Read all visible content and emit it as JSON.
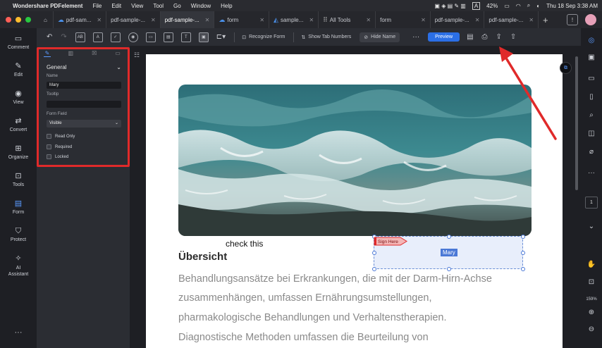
{
  "menubar": {
    "app_name": "Wondershare PDFelement",
    "items": [
      "File",
      "Edit",
      "View",
      "Tool",
      "Go",
      "Window",
      "Help"
    ],
    "battery": "42%",
    "clock": "Thu 18 Sep  3:38 AM",
    "input_indicator": "A"
  },
  "tabs": [
    {
      "label": "pdf-sam...",
      "icon": "cloud"
    },
    {
      "label": "pdf-sample-...",
      "icon": "none"
    },
    {
      "label": "pdf-sample-...",
      "icon": "none",
      "active": true
    },
    {
      "label": "form",
      "icon": "cloud"
    },
    {
      "label": "sample...",
      "icon": "chart"
    },
    {
      "label": "All Tools",
      "icon": "grid"
    },
    {
      "label": "form",
      "icon": "none"
    },
    {
      "label": "pdf-sample-...",
      "icon": "none"
    },
    {
      "label": "pdf-sample-...",
      "icon": "none"
    }
  ],
  "leftnav": [
    {
      "label": "Comment",
      "icon": "comment-icon"
    },
    {
      "label": "Edit",
      "icon": "edit-icon"
    },
    {
      "label": "View",
      "icon": "view-icon"
    },
    {
      "label": "Convert",
      "icon": "convert-icon"
    },
    {
      "label": "Organize",
      "icon": "organize-icon"
    },
    {
      "label": "Tools",
      "icon": "tools-icon"
    },
    {
      "label": "Form",
      "icon": "form-icon",
      "active": true
    },
    {
      "label": "Protect",
      "icon": "protect-icon"
    },
    {
      "label": "AI\nAssistant",
      "icon": "ai-assistant-icon"
    }
  ],
  "toolbar": {
    "recognize": "Recognize Form",
    "tab_numbers": "Show Tab Numbers",
    "hide_name": "Hide Name",
    "preview": "Preview",
    "field_icons": [
      "AB",
      "A",
      "✓",
      "◉",
      "▭",
      "▤",
      "T",
      "▣"
    ]
  },
  "props": {
    "section": "General",
    "name_label": "Name",
    "name_value": "Mary",
    "tooltip_label": "Tooltip",
    "tooltip_value": "",
    "formfield_label": "Form Field",
    "formfield_value": "Visible",
    "checks": [
      "Read Only",
      "Required",
      "Locked"
    ]
  },
  "doc": {
    "caption": "check this",
    "heading": "Übersicht",
    "paragraph": [
      "Behandlungsansätze bei Erkrankungen, die mit der Darm-Hirn-Achse",
      "zusammenhängen, umfassen Ernährungsumstellungen,",
      "pharmakologische Behandlungen und Verhaltenstherapien.",
      "Diagnostische Methoden umfassen die Beurteilung von"
    ],
    "sign_here": "Sign Here",
    "field_name": "Mary"
  },
  "rightrail": {
    "page": "1",
    "zoom": "159%"
  },
  "colors": {
    "accent": "#2b6fe6",
    "annotation": "#e02a2a"
  }
}
